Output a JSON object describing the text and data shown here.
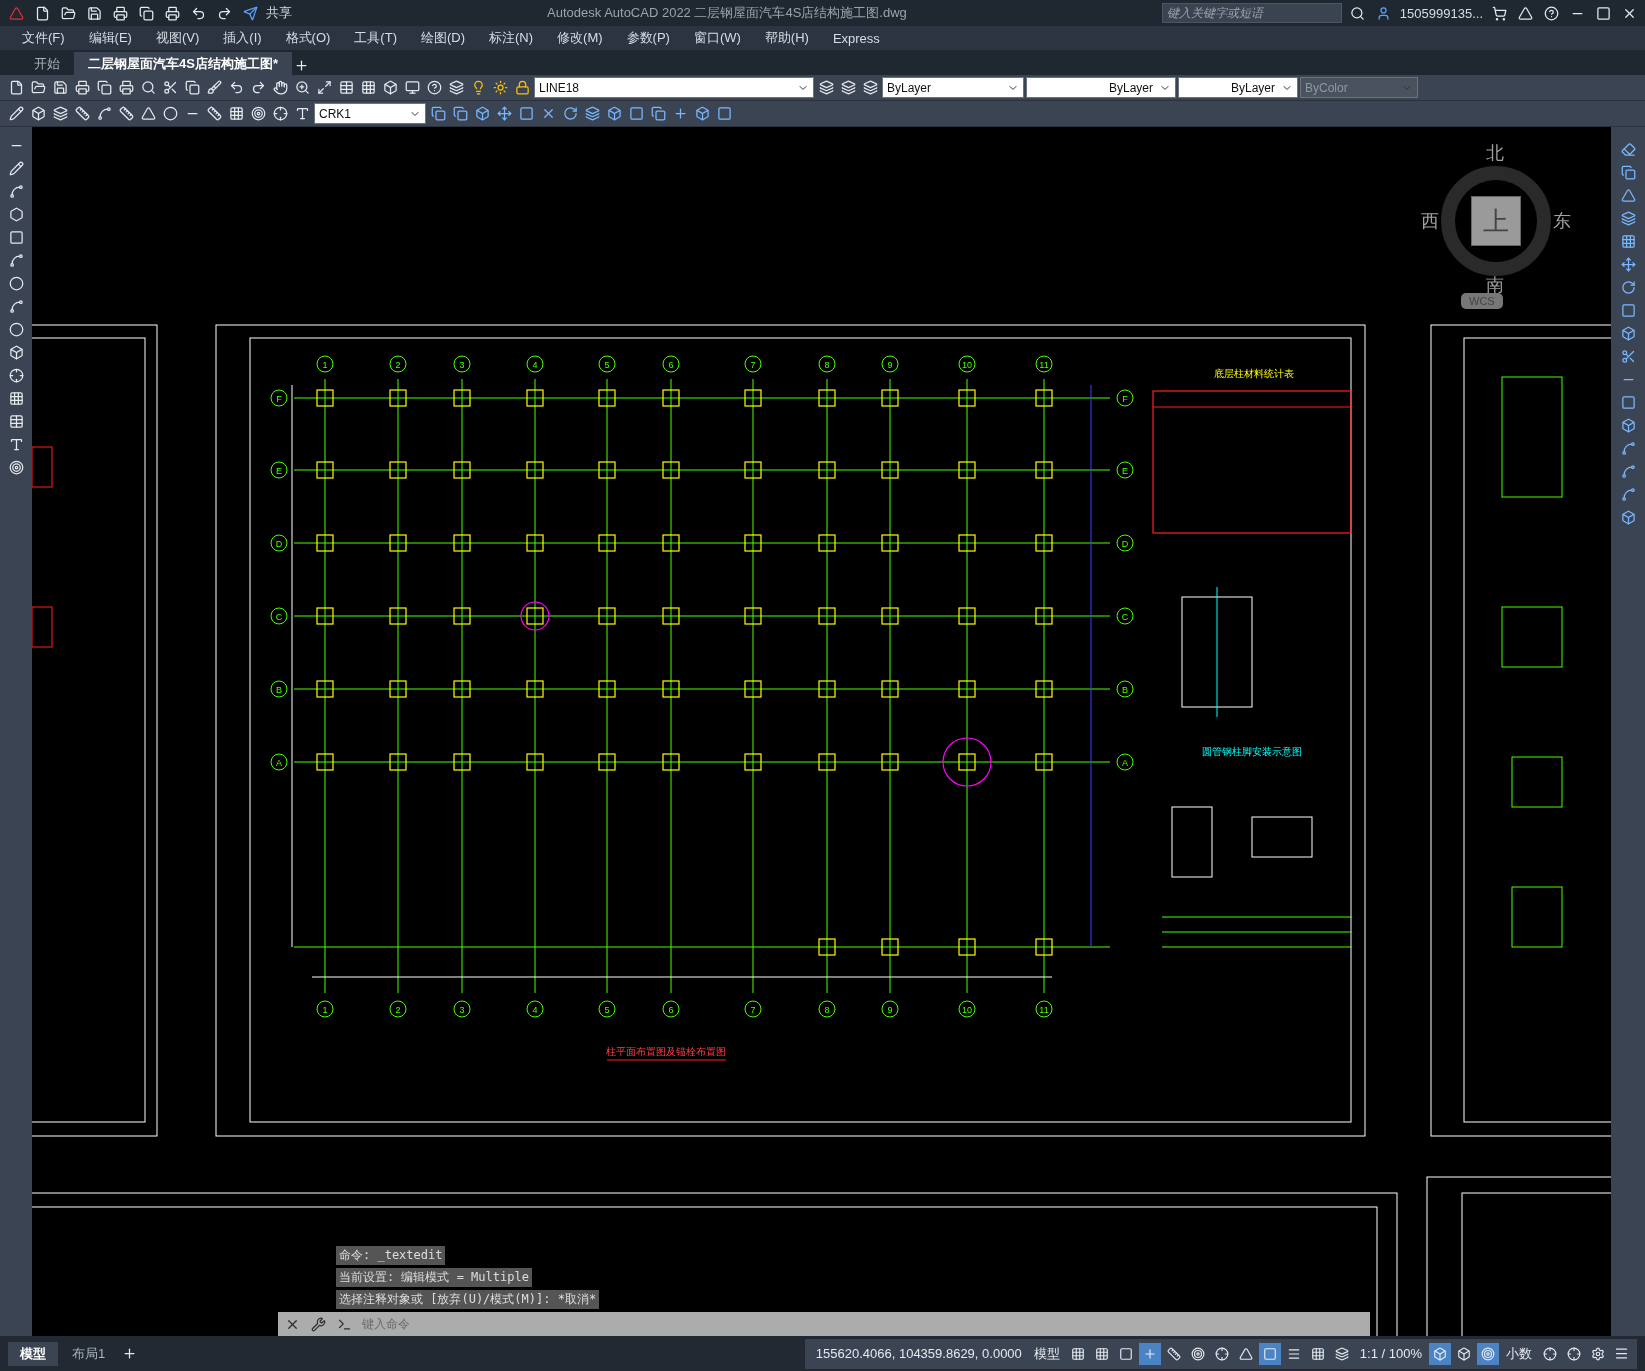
{
  "title_bar": {
    "share": "共享",
    "title": "Autodesk AutoCAD 2022    二层钢屋面汽车4S店结构施工图.dwg",
    "search": {
      "placeholder": "键入关键字或短语"
    },
    "user": "1505999135..."
  },
  "menu": [
    "文件(F)",
    "编辑(E)",
    "视图(V)",
    "插入(I)",
    "格式(O)",
    "工具(T)",
    "绘图(D)",
    "标注(N)",
    "修改(M)",
    "参数(P)",
    "窗口(W)",
    "帮助(H)",
    "Express"
  ],
  "doc_tabs": [
    {
      "label": "开始",
      "selected": false
    },
    {
      "label": "二层钢屋面汽车4S店结构施工图*",
      "selected": true
    }
  ],
  "properties": {
    "layer": "LINE18",
    "color_control": "ByLayer",
    "linetype": "ByLayer",
    "lineweight": "ByLayer",
    "plot_style": {
      "value": "ByColor",
      "disabled": true
    },
    "text_style": "CRK1"
  },
  "viewcube": {
    "north": "北",
    "south": "南",
    "west": "西",
    "east": "东",
    "face": "上",
    "ucs": "WCS"
  },
  "drawing": {
    "top_columns": [
      "1",
      "2",
      "3",
      "4",
      "5",
      "6",
      "7",
      "8",
      "9",
      "10",
      "11"
    ],
    "bottom_columns": [
      "1",
      "2",
      "3",
      "4",
      "5",
      "6",
      "7",
      "8",
      "9",
      "10",
      "11"
    ],
    "left_rows": [
      "F",
      "E",
      "D",
      "C",
      "B",
      "A"
    ],
    "right_rows": [
      "F",
      "E",
      "D",
      "C",
      "B",
      "A"
    ],
    "table_title": "底层柱材料统计表",
    "plan_title": "柱平面布置图及锚栓布置图",
    "detail_title": "圆管钢柱脚安装示意图"
  },
  "command_line": {
    "history": [
      "命令: _textedit",
      "当前设置: 编辑模式 = Multiple",
      "选择注释对象或 [放弃(U)/模式(M)]: *取消*"
    ],
    "placeholder": "键入命令"
  },
  "layout_tabs": [
    {
      "label": "模型",
      "selected": true
    },
    {
      "label": "布局1",
      "selected": false
    }
  ],
  "status_bar": {
    "coordinates": "155620.4066, 104359.8629, 0.0000",
    "space": "模型",
    "scale": "1:1 / 100%",
    "units": "小数",
    "toggles": [
      {
        "on": false
      },
      {
        "on": false
      },
      {
        "on": false
      },
      {
        "on": true
      },
      {
        "on": false
      },
      {
        "on": false
      },
      {
        "on": false
      },
      {
        "on": false
      },
      {
        "on": true
      },
      {
        "on": false
      },
      {
        "on": false
      },
      {
        "on": false
      },
      {
        "on": true
      },
      {
        "on": false
      },
      {
        "on": true
      },
      {
        "on": false
      },
      {
        "on": false
      },
      {
        "on": false
      }
    ]
  }
}
